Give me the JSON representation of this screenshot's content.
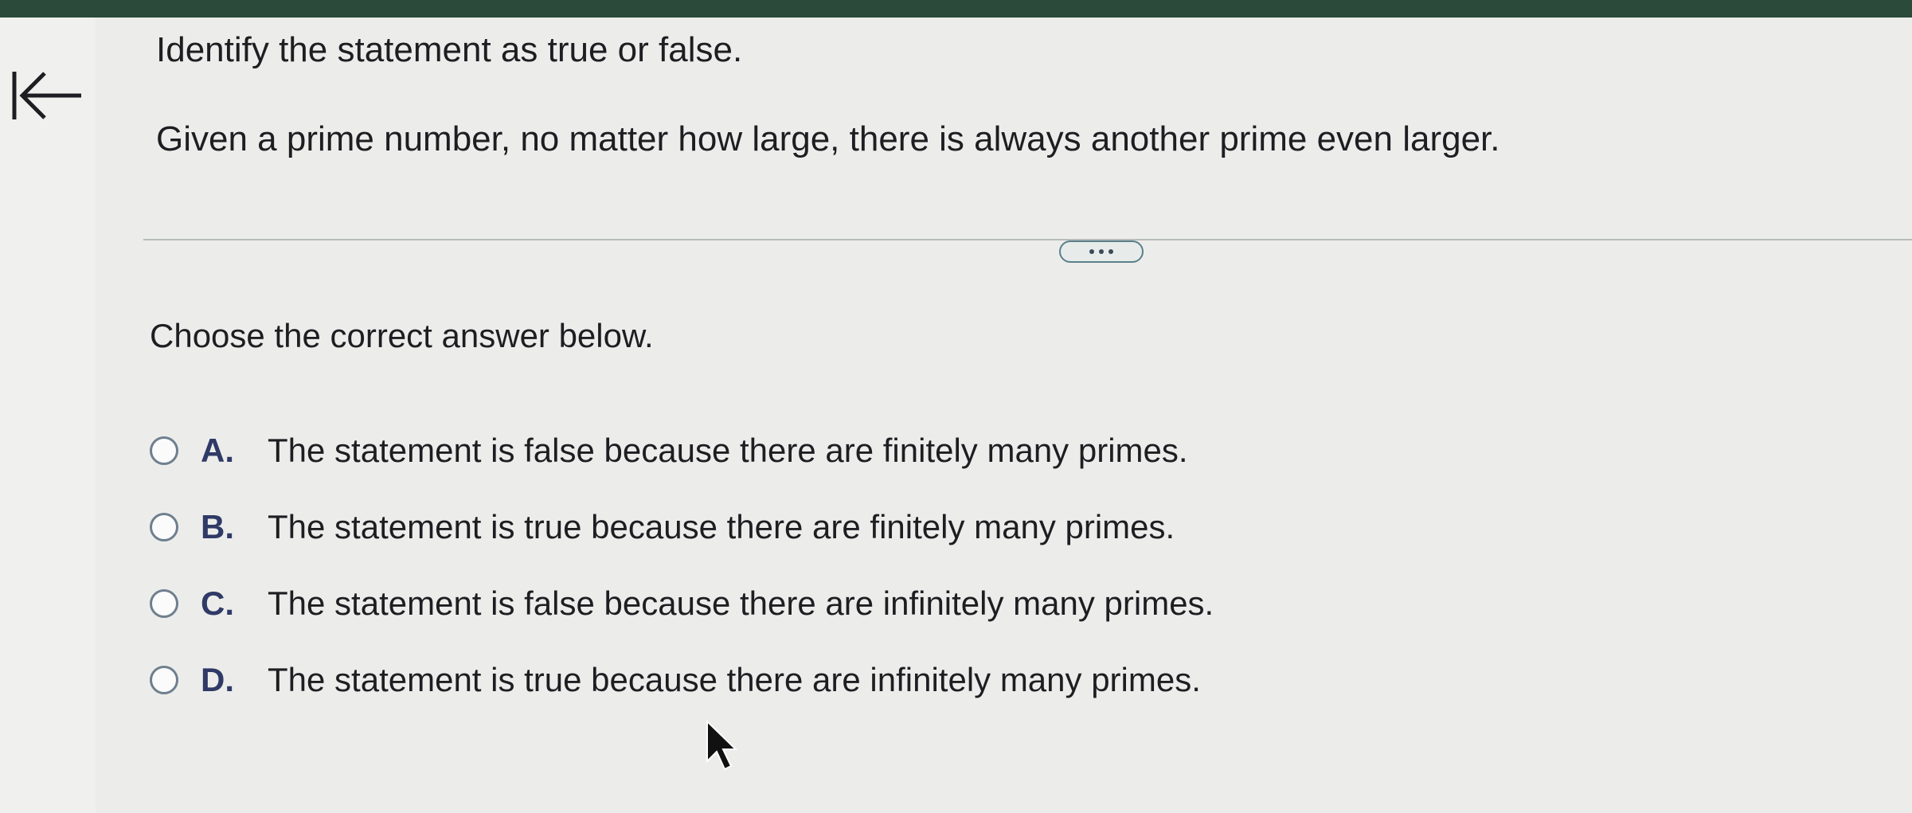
{
  "back": {
    "icon": "back-to-start-icon"
  },
  "question": {
    "title": "Identify the statement as true or false.",
    "statement": "Given a prime number, no matter how large, there is always another prime even larger."
  },
  "more_button": {
    "icon": "more-dots-icon"
  },
  "prompt": "Choose the correct answer below.",
  "options": [
    {
      "letter": "A.",
      "text": "The statement is false because there are finitely many primes."
    },
    {
      "letter": "B.",
      "text": "The statement is true because there are finitely many primes."
    },
    {
      "letter": "C.",
      "text": "The statement is false because there are infinitely many primes."
    },
    {
      "letter": "D.",
      "text": "The statement is true because there are infinitely many primes."
    }
  ],
  "colors": {
    "background": "#ecedeb",
    "text": "#1e1e22",
    "letter": "#2f3a66",
    "radio_border": "#6f7f8f",
    "button_border": "#5b7f8c"
  }
}
